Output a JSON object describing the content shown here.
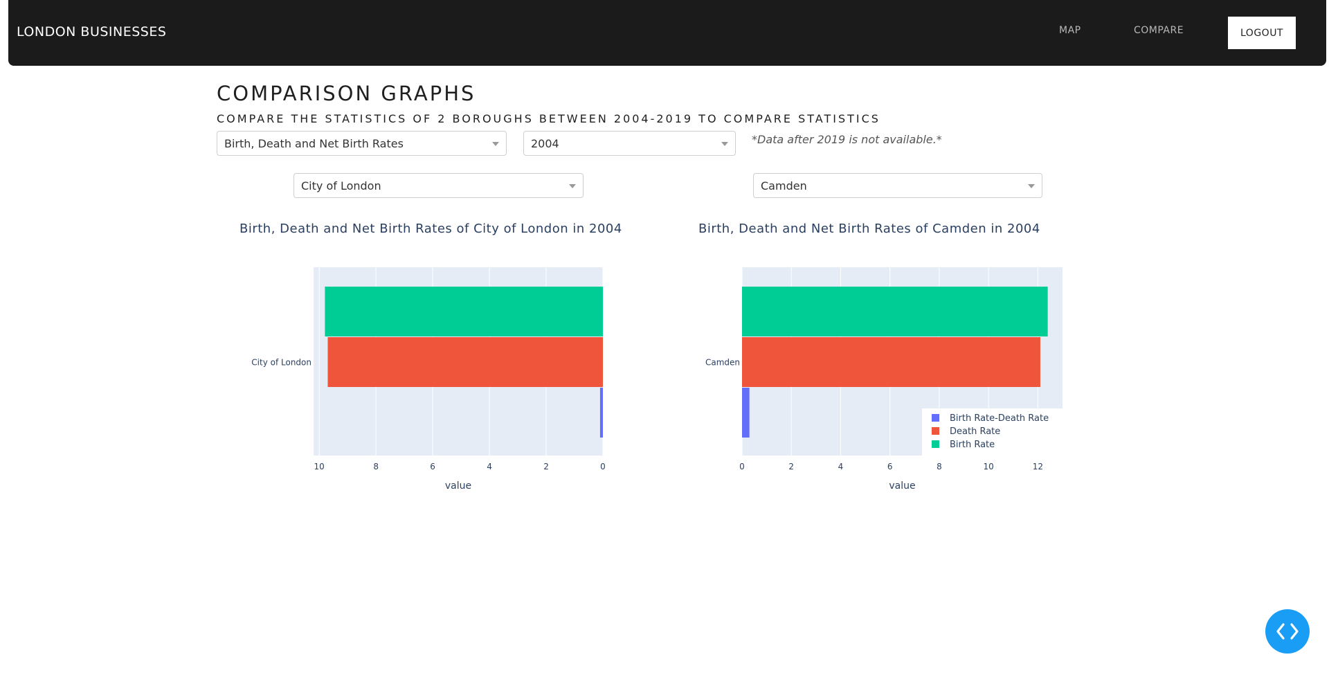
{
  "navbar": {
    "brand": "LONDON BUSINESSES",
    "links": [
      {
        "label": "MAP"
      },
      {
        "label": "COMPARE"
      }
    ],
    "logout_label": "LOGOUT"
  },
  "header": {
    "title": "COMPARISON GRAPHS",
    "subtitle": "COMPARE THE STATISTICS OF 2 BOROUGHS BETWEEN 2004-2019 TO COMPARE STATISTICS"
  },
  "controls": {
    "metric_value": "Birth, Death and Net Birth Rates",
    "year_value": "2004",
    "note": "*Data after 2019 is not available.*",
    "borough_left_value": "City of London",
    "borough_right_value": "Camden"
  },
  "colors": {
    "birth_rate": "#00cc96",
    "death_rate": "#ef553b",
    "net_rate": "#636efa",
    "plot_bg": "#e5ecf6",
    "accent": "#1a9ef5"
  },
  "chart_data": [
    {
      "type": "bar",
      "orientation": "horizontal",
      "title": "Birth, Death and Net Birth Rates of City of London in 2004",
      "xlabel": "value",
      "ylabel": "",
      "category": "City of London",
      "x_reversed": true,
      "xlim": [
        0,
        10.2
      ],
      "xticks": [
        "10",
        "8",
        "6",
        "4",
        "2",
        "0"
      ],
      "grid": true,
      "series": [
        {
          "name": "Birth Rate-Death Rate",
          "value": 0.1
        },
        {
          "name": "Death Rate",
          "value": 9.7
        },
        {
          "name": "Birth Rate",
          "value": 9.8
        }
      ]
    },
    {
      "type": "bar",
      "orientation": "horizontal",
      "title": "Birth, Death and Net Birth Rates of Camden in 2004",
      "xlabel": "value",
      "ylabel": "",
      "category": "Camden",
      "x_reversed": false,
      "xlim": [
        0,
        13
      ],
      "xticks": [
        "0",
        "2",
        "4",
        "6",
        "8",
        "10",
        "12"
      ],
      "grid": true,
      "legend_position": "bottom-right",
      "series": [
        {
          "name": "Birth Rate-Death Rate",
          "value": 0.3
        },
        {
          "name": "Death Rate",
          "value": 12.1
        },
        {
          "name": "Birth Rate",
          "value": 12.4
        }
      ]
    }
  ]
}
